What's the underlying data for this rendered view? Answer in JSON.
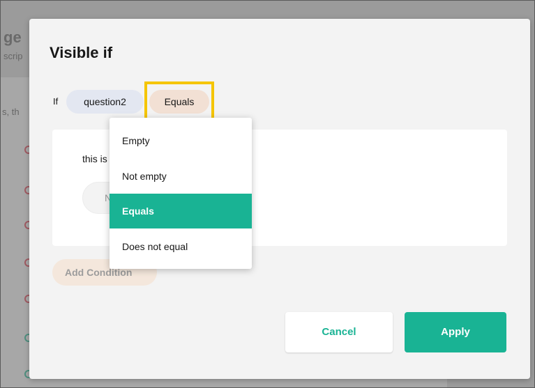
{
  "background": {
    "heading_fragment": "ge",
    "subheading_fragment": "scrip",
    "text_fragment": "s, th",
    "bottom_fragment": "None"
  },
  "modal": {
    "title": "Visible if",
    "if_label": "If",
    "question_value": "question2",
    "operator_value": "Equals",
    "card_text_fragment": "this is",
    "card_input_fragment": "N",
    "add_condition_label": "Add Condition",
    "cancel_label": "Cancel",
    "apply_label": "Apply"
  },
  "operator_dropdown": {
    "options": [
      "Empty",
      "Not empty",
      "Equals",
      "Does not equal"
    ],
    "selected": "Equals"
  },
  "colors": {
    "accent": "#19b394",
    "highlight": "#f5c500",
    "question_pill": "#e3e7f1",
    "operator_pill": "#f2e0d4"
  }
}
